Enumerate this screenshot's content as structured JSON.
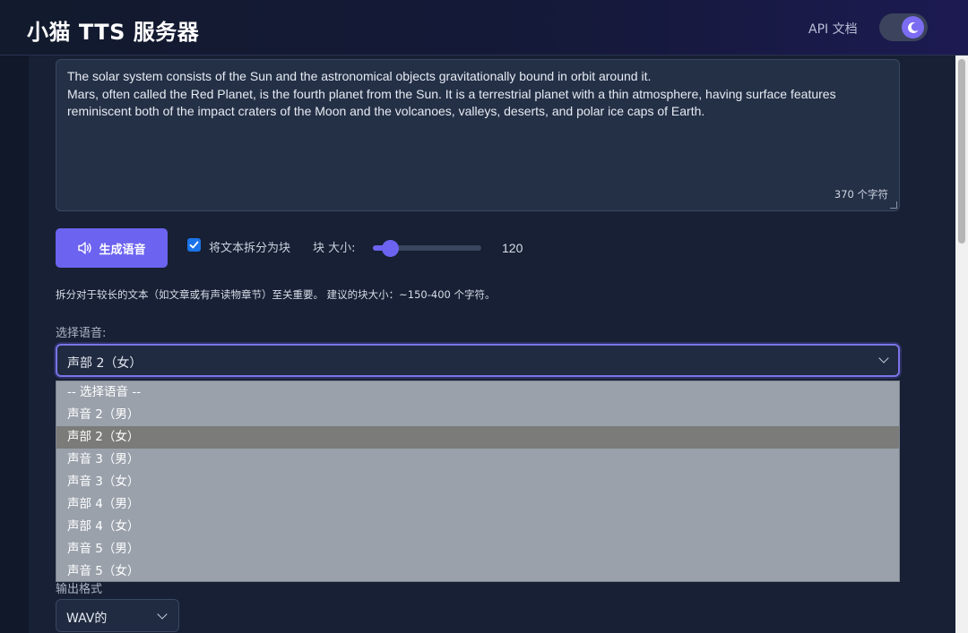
{
  "header": {
    "title": "小猫 TTS 服务器",
    "api_link": "API 文档"
  },
  "input": {
    "text": "The solar system consists of the Sun and the astronomical objects gravitationally bound in orbit around it.\nMars, often called the Red Planet, is the fourth planet from the Sun. It is a terrestrial planet with a thin atmosphere, having surface features reminiscent both of the impact craters of the Moon and the volcanoes, valleys, deserts, and polar ice caps of Earth.",
    "char_count": "370 个字符"
  },
  "controls": {
    "generate_label": "生成语音",
    "split_label": "将文本拆分为块",
    "split_checked": true,
    "chunk_size_label": "块 大小:",
    "chunk_size_value": "120",
    "chunk_fraction": 0.1,
    "hint": "拆分对于较长的文本（如文章或有声读物章节）至关重要。 建议的块大小：~150-400 个字符。"
  },
  "voice": {
    "label": "选择语音:",
    "selected": "声部 2（女）",
    "options": [
      "-- 选择语音 --",
      "声音 2（男）",
      "声部 2（女）",
      "声音 3（男）",
      "声音 3（女）",
      "声部 4（男）",
      "声部 4（女）",
      "声音 5（男）",
      "声音 5（女）"
    ],
    "selected_index": 2
  },
  "format": {
    "label": "输出格式",
    "value": "WAV的"
  },
  "colors": {
    "accent": "#6c63f0",
    "background": "#172034",
    "checkbox": "#1a73e8"
  }
}
